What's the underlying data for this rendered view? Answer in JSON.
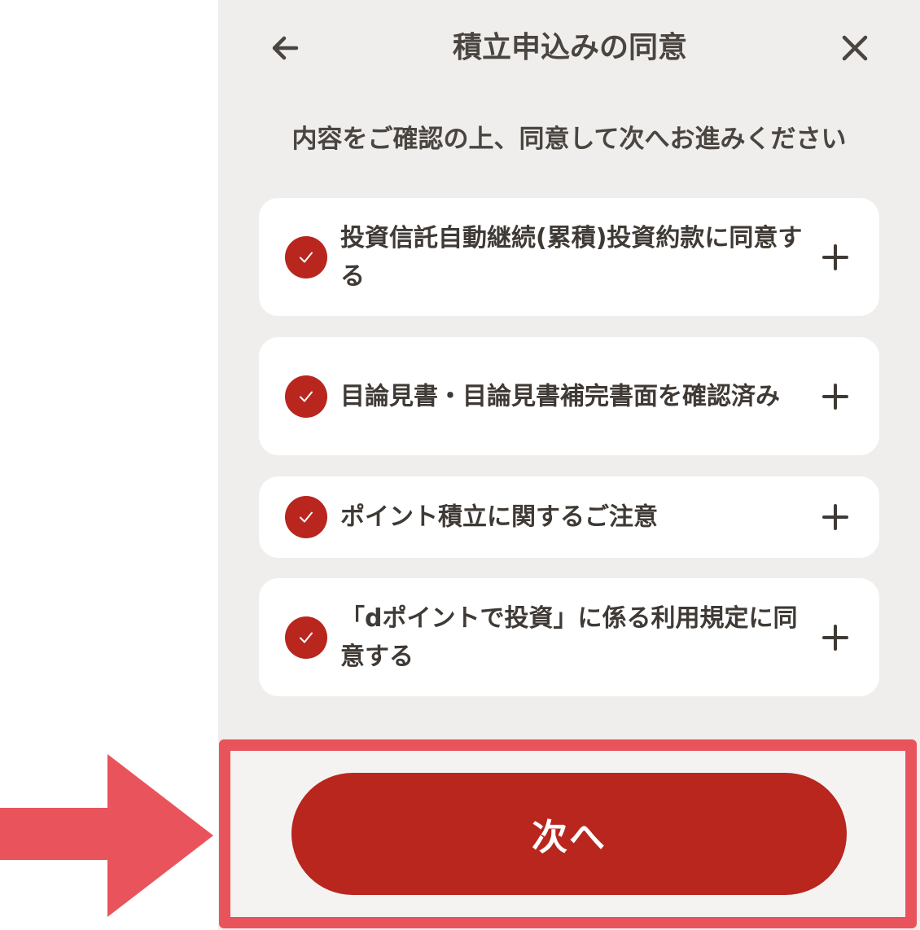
{
  "header": {
    "title": "積立申込みの同意",
    "back_icon": "arrow-left-icon",
    "close_icon": "close-icon"
  },
  "instruction": "内容をご確認の上、同意して次へお進みください",
  "agreements": [
    {
      "label": "投資信託自動継続(累積)投資約款に同意する",
      "checked": true
    },
    {
      "label": "目論見書・目論見書補完書面を確認済み",
      "checked": true
    },
    {
      "label": "ポイント積立に関するご注意",
      "checked": true
    },
    {
      "label": "「dポイントで投資」に係る利用規定に同意する",
      "checked": true
    }
  ],
  "footer": {
    "next_label": "次へ"
  },
  "colors": {
    "accent": "#b8261e",
    "panel_background": "#efeeec",
    "text": "#3f3a35",
    "annotation": "#e9535b"
  }
}
